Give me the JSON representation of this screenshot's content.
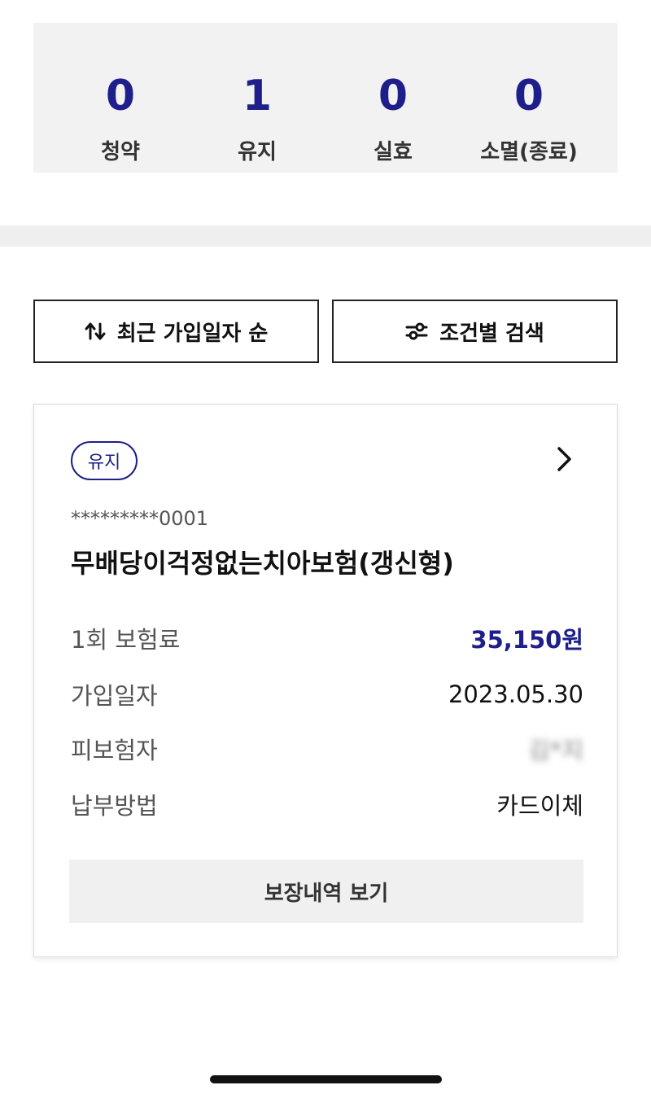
{
  "summary": {
    "items": [
      {
        "count": "0",
        "label": "청약"
      },
      {
        "count": "1",
        "label": "유지"
      },
      {
        "count": "0",
        "label": "실효"
      },
      {
        "count": "0",
        "label": "소멸(종료)"
      }
    ]
  },
  "filters": {
    "sort_label": "최근 가입일자 순",
    "sort_icon": "sort-arrows-icon",
    "search_label": "조건별 검색",
    "search_icon": "sliders-icon"
  },
  "card": {
    "status": "유지",
    "policy_number": "*********0001",
    "product_name": "무배당이걱정없는치아보험(갱신형)",
    "rows": [
      {
        "key": "1회 보험료",
        "value": "35,150원"
      },
      {
        "key": "가입일자",
        "value": "2023.05.30"
      },
      {
        "key": "피보험자",
        "value": "김*지"
      },
      {
        "key": "납부방법",
        "value": "카드이체"
      }
    ],
    "detail_button": "보장내역 보기",
    "chevron_icon": "chevron-right-icon"
  },
  "colors": {
    "accent": "#1e1f8a",
    "summary_bg": "#f2f2f2",
    "button_bg": "#f0f0f0"
  }
}
